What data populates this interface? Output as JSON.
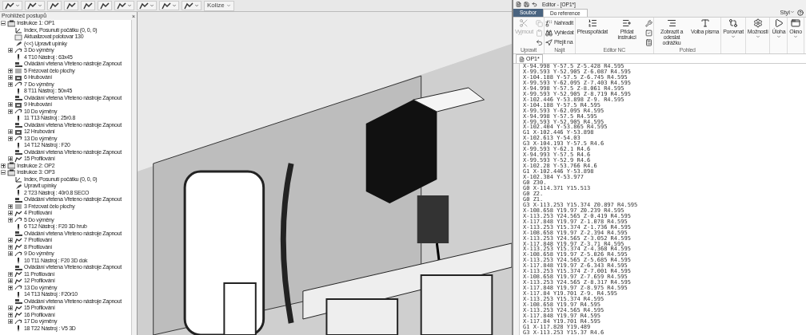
{
  "toolbar": {
    "buttons": [
      {
        "dropdown": true
      },
      {
        "dropdown": true
      },
      {
        "dropdown": false
      },
      {
        "dropdown": false
      },
      {
        "dropdown": false
      },
      {
        "dropdown": false
      },
      {
        "dropdown": true
      },
      {
        "dropdown": true
      },
      {
        "dropdown": true
      },
      {
        "dropdown": true
      }
    ],
    "collision_button": {
      "label": "Kolize",
      "dropdown": true
    }
  },
  "procedure_browser": {
    "title": "Prohlížeč postupů",
    "close": "×",
    "tree": [
      {
        "label": "Instrukce 1: OP1",
        "kind": "setup",
        "expanded": true,
        "children": [
          {
            "label": "Index, Posunutí počátku (0, 0, 0)",
            "kind": "index"
          },
          {
            "label": "Aktualizovat polotovar 130",
            "kind": "stock"
          },
          {
            "label": "(<<) Upravit upínky",
            "kind": "clamp"
          },
          {
            "label": "3 Do výměny",
            "kind": "change",
            "expanded": false
          },
          {
            "label": "4 T10 Nástroj : 63x45",
            "kind": "tool"
          },
          {
            "label": "Ovládání vřetena Vřeteno nástroje Zapnout",
            "kind": "spindle"
          },
          {
            "label": "5 Frézovat čelo plochy",
            "kind": "facing",
            "expanded": false
          },
          {
            "label": "6 Hrubování",
            "kind": "roughing",
            "expanded": false
          },
          {
            "label": "7 Do výměny",
            "kind": "change",
            "expanded": false
          },
          {
            "label": "8 T11 Nástroj : 50x45",
            "kind": "tool"
          },
          {
            "label": "Ovládání vřetena Vřeteno nástroje Zapnout",
            "kind": "spindle"
          },
          {
            "label": "9 Hrubování",
            "kind": "roughing",
            "expanded": false
          },
          {
            "label": "10 Do výměny",
            "kind": "change",
            "expanded": false
          },
          {
            "label": "11 T13 Nástroj : 25r0.8",
            "kind": "tool"
          },
          {
            "label": "Ovládání vřetena Vřeteno nástroje Zapnout",
            "kind": "spindle"
          },
          {
            "label": "12 Hrubování",
            "kind": "roughing",
            "expanded": false
          },
          {
            "label": "13 Do výměny",
            "kind": "change",
            "expanded": false
          },
          {
            "label": "14 T12 Nástroj : F20",
            "kind": "tool"
          },
          {
            "label": "Ovládání vřetena Vřeteno nástroje Zapnout",
            "kind": "spindle"
          },
          {
            "label": "15 Profilování",
            "kind": "profiling",
            "expanded": false
          }
        ]
      },
      {
        "label": "Instrukce 2: OP2",
        "kind": "setup",
        "expanded": false
      },
      {
        "label": "Instrukce 3: OP3",
        "kind": "setup",
        "expanded": true,
        "children": [
          {
            "label": "Index, Posunutí počátku (0, 0, 0)",
            "kind": "index"
          },
          {
            "label": "Upravit upínky",
            "kind": "clamp"
          },
          {
            "label": "2 T23 Nástroj : 40r0.8 SECO",
            "kind": "tool"
          },
          {
            "label": "Ovládání vřetena Vřeteno nástroje Zapnout",
            "kind": "spindle"
          },
          {
            "label": "3 Frézovat čelo plochy",
            "kind": "facing",
            "expanded": false
          },
          {
            "label": "4 Profilování",
            "kind": "profiling",
            "expanded": false
          },
          {
            "label": "5 Do výměny",
            "kind": "change",
            "expanded": false
          },
          {
            "label": "6 T12 Nástroj : F20 3D hrub",
            "kind": "tool"
          },
          {
            "label": "Ovládání vřetena Vřeteno nástroje Zapnout",
            "kind": "spindle"
          },
          {
            "label": "7 Profilování",
            "kind": "profiling",
            "expanded": false
          },
          {
            "label": "8 Profilování",
            "kind": "profiling",
            "expanded": false
          },
          {
            "label": "9 Do výměny",
            "kind": "change",
            "expanded": false
          },
          {
            "label": "10 T11 Nástroj : F20 3D dok",
            "kind": "tool"
          },
          {
            "label": "Ovládání vřetena Vřeteno nástroje Zapnout",
            "kind": "spindle"
          },
          {
            "label": "11 Profilování",
            "kind": "profiling",
            "expanded": false
          },
          {
            "label": "12 Profilování",
            "kind": "profiling",
            "expanded": false
          },
          {
            "label": "13 Do výměny",
            "kind": "change",
            "expanded": false
          },
          {
            "label": "14 T13 Nástroj : F20r10",
            "kind": "tool"
          },
          {
            "label": "Ovládání vřetena Vřeteno nástroje Zapnout",
            "kind": "spindle"
          },
          {
            "label": "15 Profilování",
            "kind": "profiling",
            "expanded": false
          },
          {
            "label": "16 Profilování",
            "kind": "profiling",
            "expanded": false
          },
          {
            "label": "17 Do výměny",
            "kind": "change",
            "expanded": false
          },
          {
            "label": "18 T22 Nástroj : V5 3D",
            "kind": "tool"
          }
        ]
      }
    ]
  },
  "editor": {
    "title": "Editor - [OP1*]",
    "tabs": [
      {
        "label": "Soubor",
        "kind": "file",
        "selected": false
      },
      {
        "label": "Do reference",
        "kind": "tab",
        "selected": true
      }
    ],
    "style_menu": "Styl",
    "groups": [
      {
        "label": "Upravit",
        "buttons": [
          {
            "label": "Vyjmout",
            "kind": "large",
            "disabled": true
          },
          {
            "kind": "small",
            "disabled": true
          },
          {
            "kind": "small",
            "disabled": true
          },
          {
            "kind": "small",
            "disabled": false
          }
        ]
      },
      {
        "label": "Najít",
        "buttons": [
          {
            "label": "Nahradit",
            "kind": "small",
            "disabled": false
          },
          {
            "label": "Vyhledat",
            "kind": "small",
            "disabled": false
          },
          {
            "label": "Přejít na",
            "kind": "small",
            "disabled": false
          }
        ]
      },
      {
        "label": "Editor NC",
        "buttons": [
          {
            "label": "Přeuspořádat",
            "kind": "large",
            "disabled": false
          },
          {
            "label": "Přidat instrukci",
            "kind": "large",
            "disabled": false
          },
          {
            "kind": "small",
            "disabled": false
          },
          {
            "kind": "small",
            "disabled": false
          },
          {
            "kind": "small",
            "disabled": false
          }
        ]
      },
      {
        "label": "Pohled",
        "buttons": [
          {
            "label": "Zobrazit a odeslat odrážku",
            "kind": "large",
            "disabled": false
          },
          {
            "label": "Volba písma",
            "kind": "large",
            "disabled": false
          }
        ]
      },
      {
        "buttons": [
          {
            "label": "Porovnat",
            "kind": "menu",
            "disabled": false
          }
        ]
      },
      {
        "buttons": [
          {
            "label": "Možnosti",
            "kind": "menu",
            "disabled": false
          }
        ]
      },
      {
        "buttons": [
          {
            "label": "Úloha",
            "kind": "menu",
            "disabled": false
          }
        ]
      },
      {
        "buttons": [
          {
            "label": "Okno",
            "kind": "menu",
            "disabled": false
          }
        ]
      }
    ],
    "document_tab": "OP1*",
    "lines": [
      "X-94.998 Y-57.5 Z-5.428 R4.595",
      "X-99.593 Y-52.905 Z-6.087 R4.595",
      "X-104.188 Y-57.5 Z-6.745 R4.595",
      "X-99.593 Y-62.095 Z-7.403 R4.595",
      "X-94.998 Y-57.5 Z-8.061 R4.595",
      "X-99.593 Y-52.905 Z-8.719 R4.595",
      "X-102.446 Y-53.898 Z-9. R4.595",
      "X-104.188 Y-57.5 R4.595",
      "X-99.593 Y-62.095 R4.595",
      "X-94.998 Y-57.5 R4.595",
      "X-99.593 Y-52.905 R4.595",
      "X-102.404 Y-53.865 R4.595",
      "G1 X-102.446 Y-53.898",
      "X-102.613 Y-54.03",
      "G3 X-104.193 Y-57.5 R4.6",
      "X-99.593 Y-62.1 R4.6",
      "X-94.993 Y-57.5 R4.6",
      "X-99.593 Y-52.9 R4.6",
      "X-102.28 Y-53.766 R4.6",
      "G1 X-102.446 Y-53.898",
      "X-102.384 Y-53.977",
      "G0 Z30.",
      "G0 X-114.371 Y15.513",
      "G0 Z2.",
      "G0 Z1.",
      "G3 X-113.253 Y15.374 Z0.897 R4.595",
      "X-108.658 Y19.97 Z0.239 R4.595",
      "X-113.253 Y24.565 Z-0.419 R4.595",
      "X-117.848 Y19.97 Z-1.078 R4.595",
      "X-113.253 Y15.374 Z-1.736 R4.595",
      "X-108.658 Y19.97 Z-2.394 R4.595",
      "X-113.253 Y24.565 Z-3.052 R4.595",
      "X-117.848 Y19.97 Z-3.71 R4.595",
      "X-113.253 Y15.374 Z-4.368 R4.595",
      "X-108.658 Y19.97 Z-5.026 R4.595",
      "X-113.253 Y24.565 Z-5.685 R4.595",
      "X-117.848 Y19.97 Z-6.343 R4.595",
      "X-113.253 Y15.374 Z-7.001 R4.595",
      "X-108.658 Y19.97 Z-7.659 R4.595",
      "X-113.253 Y24.565 Z-8.317 R4.595",
      "X-117.848 Y19.97 Z-8.975 R4.595",
      "X-117.84 Y19.701 Z-9. R4.595",
      "X-113.253 Y15.374 R4.595",
      "X-108.658 Y19.97 R4.595",
      "X-113.253 Y24.565 R4.595",
      "X-117.848 Y19.97 R4.595",
      "X-117.84 Y19.701 R4.595",
      "G1 X-117.828 Y19.489",
      "G3 X-113.253 Y15.37 R4.6"
    ]
  }
}
